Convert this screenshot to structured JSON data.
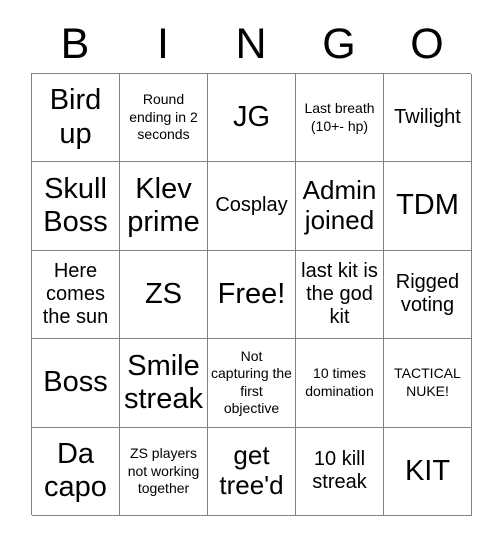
{
  "card": {
    "header_letters": [
      "B",
      "I",
      "N",
      "G",
      "O"
    ],
    "rows": [
      [
        {
          "text": "Bird up",
          "size": "t-xl"
        },
        {
          "text": "Round ending in 2 seconds",
          "size": "t-sm"
        },
        {
          "text": "JG",
          "size": "t-xl"
        },
        {
          "text": "Last breath (10+- hp)",
          "size": "t-sm"
        },
        {
          "text": "Twilight",
          "size": "t-md"
        }
      ],
      [
        {
          "text": "Skull Boss",
          "size": "t-xl"
        },
        {
          "text": "Klev prime",
          "size": "t-xl"
        },
        {
          "text": "Cosplay",
          "size": "t-md"
        },
        {
          "text": "Admin joined",
          "size": "t-lg"
        },
        {
          "text": "TDM",
          "size": "t-xl"
        }
      ],
      [
        {
          "text": "Here comes the sun",
          "size": "t-md"
        },
        {
          "text": "ZS",
          "size": "t-xl"
        },
        {
          "text": "Free!",
          "size": "t-xl"
        },
        {
          "text": "last kit is the god kit",
          "size": "t-md"
        },
        {
          "text": "Rigged voting",
          "size": "t-md"
        }
      ],
      [
        {
          "text": "Boss",
          "size": "t-xl"
        },
        {
          "text": "Smile streak",
          "size": "t-xl"
        },
        {
          "text": "Not capturing the first objective",
          "size": "t-sm"
        },
        {
          "text": "10 times domination",
          "size": "t-sm"
        },
        {
          "text": "TACTICAL NUKE!",
          "size": "t-sm"
        }
      ],
      [
        {
          "text": "Da capo",
          "size": "t-xl"
        },
        {
          "text": "ZS players not working together",
          "size": "t-sm"
        },
        {
          "text": "get tree'd",
          "size": "t-lg"
        },
        {
          "text": "10 kill streak",
          "size": "t-md"
        },
        {
          "text": "KIT",
          "size": "t-xl"
        }
      ]
    ]
  },
  "colors": {
    "background": "#ffffff",
    "grid_line": "#808080",
    "text": "#000000"
  }
}
